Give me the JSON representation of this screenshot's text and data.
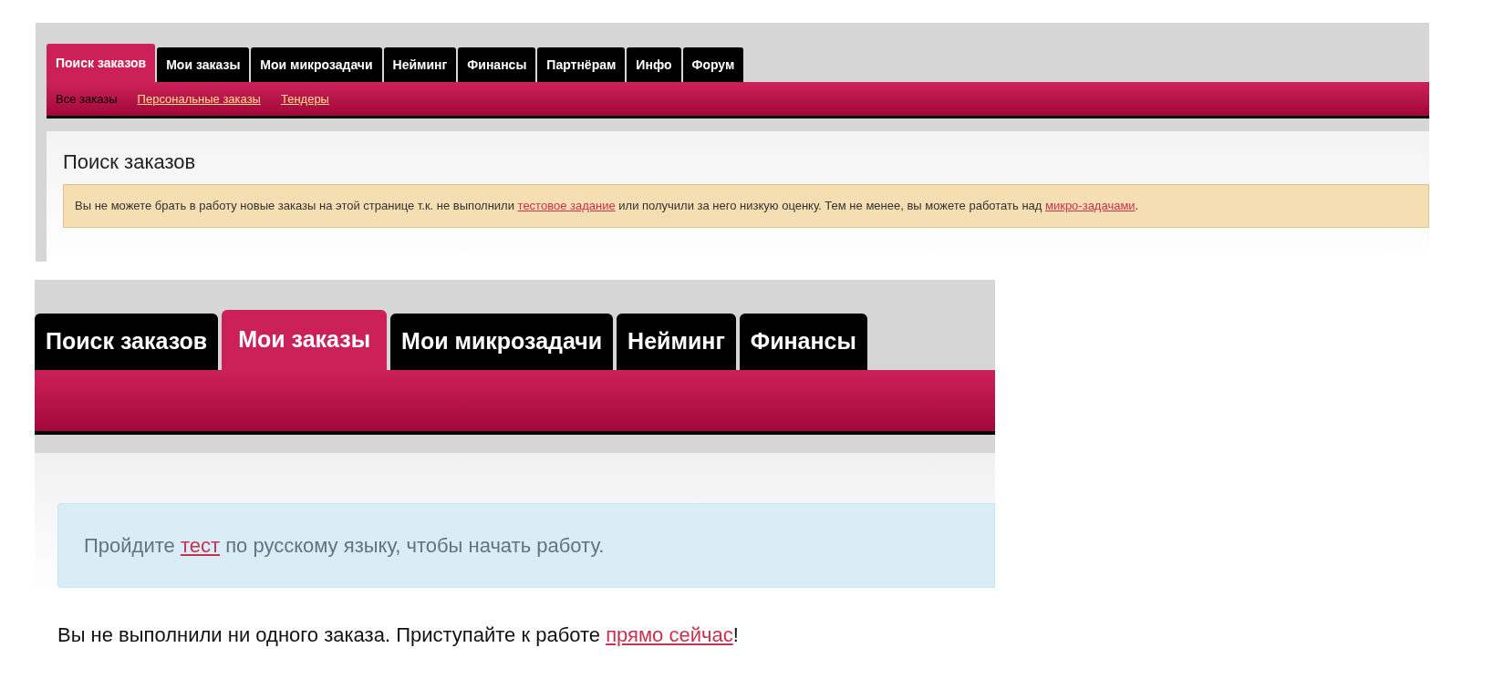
{
  "top_screenshot": {
    "tabs": [
      {
        "label": "Поиск заказов",
        "selected": true
      },
      {
        "label": "Мои заказы",
        "selected": false
      },
      {
        "label": "Мои микрозадачи",
        "selected": false
      },
      {
        "label": "Нейминг",
        "selected": false
      },
      {
        "label": "Финансы",
        "selected": false
      },
      {
        "label": "Партнёрам",
        "selected": false
      },
      {
        "label": "Инфо",
        "selected": false
      },
      {
        "label": "Форум",
        "selected": false
      }
    ],
    "subtabs": [
      {
        "label": "Все заказы",
        "selected": true
      },
      {
        "label": "Персональные заказы",
        "selected": false
      },
      {
        "label": "Тендеры",
        "selected": false
      }
    ],
    "heading": "Поиск заказов",
    "warning": [
      {
        "kind": "text",
        "text": "Вы не можете брать в работу новые заказы на этой странице т.к. не выполнили "
      },
      {
        "kind": "link",
        "text": "тестовое задание"
      },
      {
        "kind": "text",
        "text": " или получили за него низкую оценку. Тем не менее, вы можете работать над "
      },
      {
        "kind": "link",
        "text": "микро-задачами"
      },
      {
        "kind": "text",
        "text": "."
      }
    ]
  },
  "bottom_screenshot": {
    "tabs": [
      {
        "label": "Поиск заказов",
        "selected": false
      },
      {
        "label": "Мои заказы",
        "selected": true
      },
      {
        "label": "Мои микрозадачи",
        "selected": false
      },
      {
        "label": "Нейминг",
        "selected": false
      },
      {
        "label": "Финансы",
        "selected": false
      }
    ],
    "info": [
      {
        "kind": "text",
        "text": "Пройдите "
      },
      {
        "kind": "link",
        "text": "тест"
      },
      {
        "kind": "text",
        "text": " по русскому языку, чтобы начать работу."
      }
    ],
    "message": [
      {
        "kind": "text",
        "text": "Вы не выполнили ни одного заказа. Приступайте к работе "
      },
      {
        "kind": "link",
        "text": "прямо сейчас"
      },
      {
        "kind": "text",
        "text": "!"
      }
    ]
  }
}
